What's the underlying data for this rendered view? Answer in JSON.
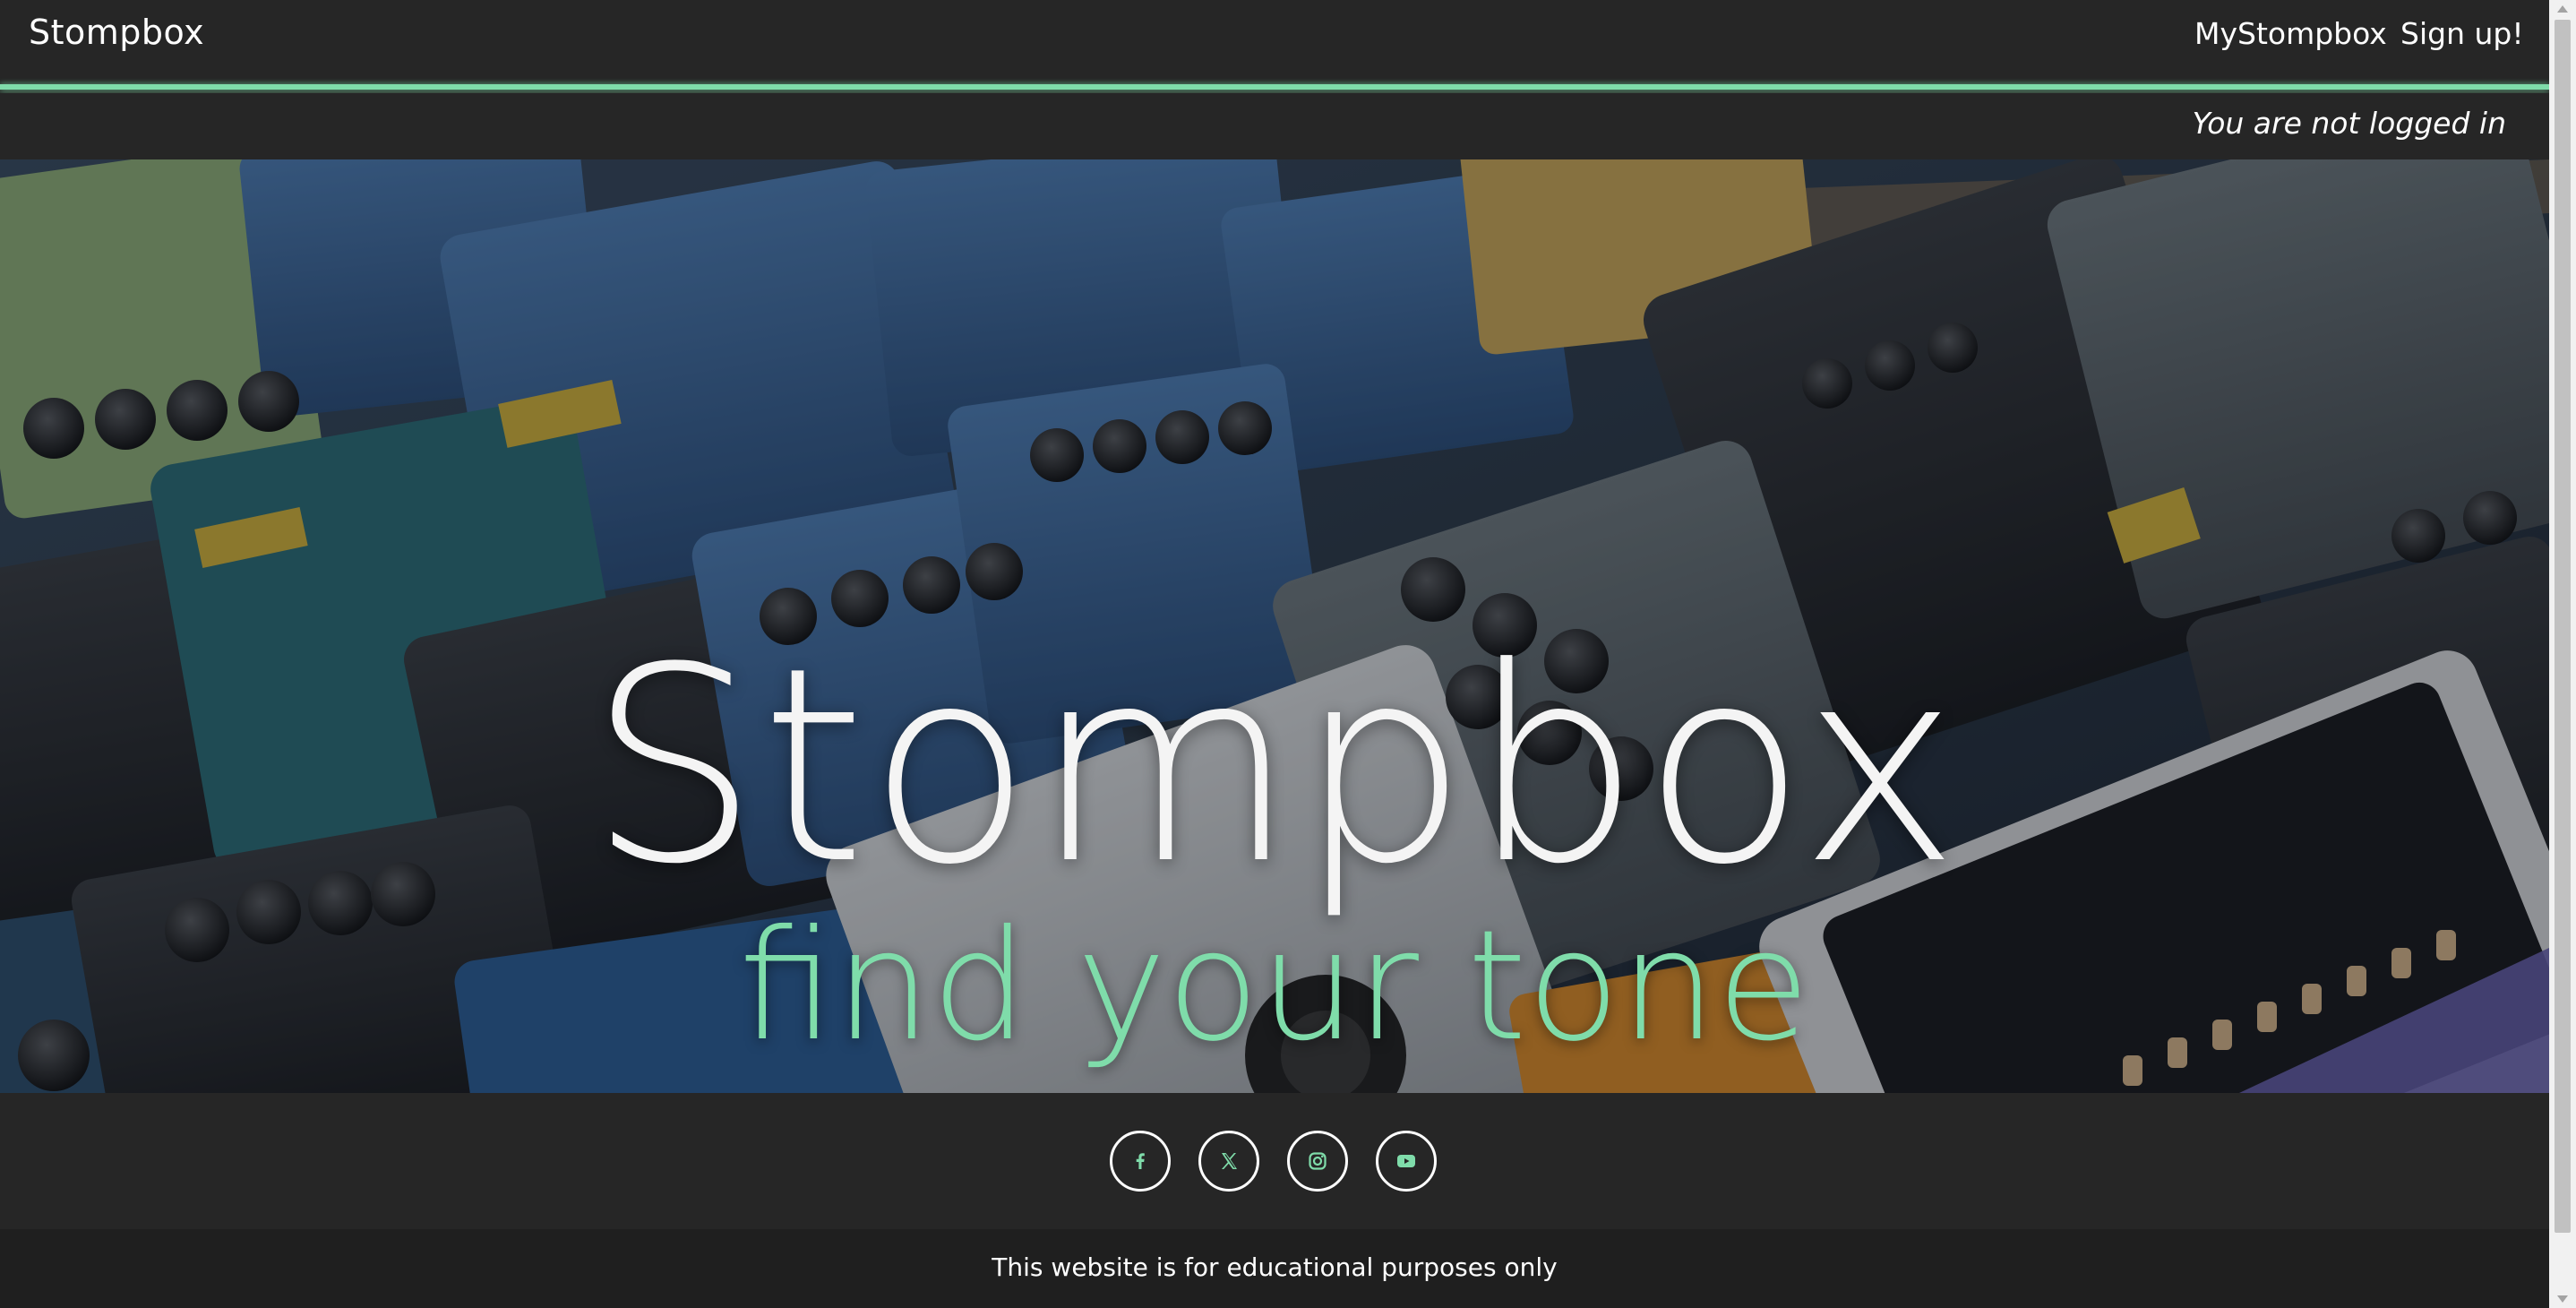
{
  "navbar": {
    "brand": "Stompbox",
    "links": [
      {
        "label": "MyStompbox"
      },
      {
        "label": "Sign up!"
      }
    ]
  },
  "status": {
    "login_text": "You are not logged in"
  },
  "hero": {
    "title": "Stompbox",
    "tagline": "find your tone",
    "background": "guitar-effects-pedals-photo"
  },
  "social": {
    "icons": [
      "facebook-icon",
      "x-icon",
      "instagram-icon",
      "youtube-icon"
    ]
  },
  "footer": {
    "text": "This website is for educational purposes only"
  },
  "colors": {
    "background": "#262626",
    "accent": "#7fdcaa",
    "footer_bg": "#1f1f1f",
    "text": "#ffffff"
  }
}
